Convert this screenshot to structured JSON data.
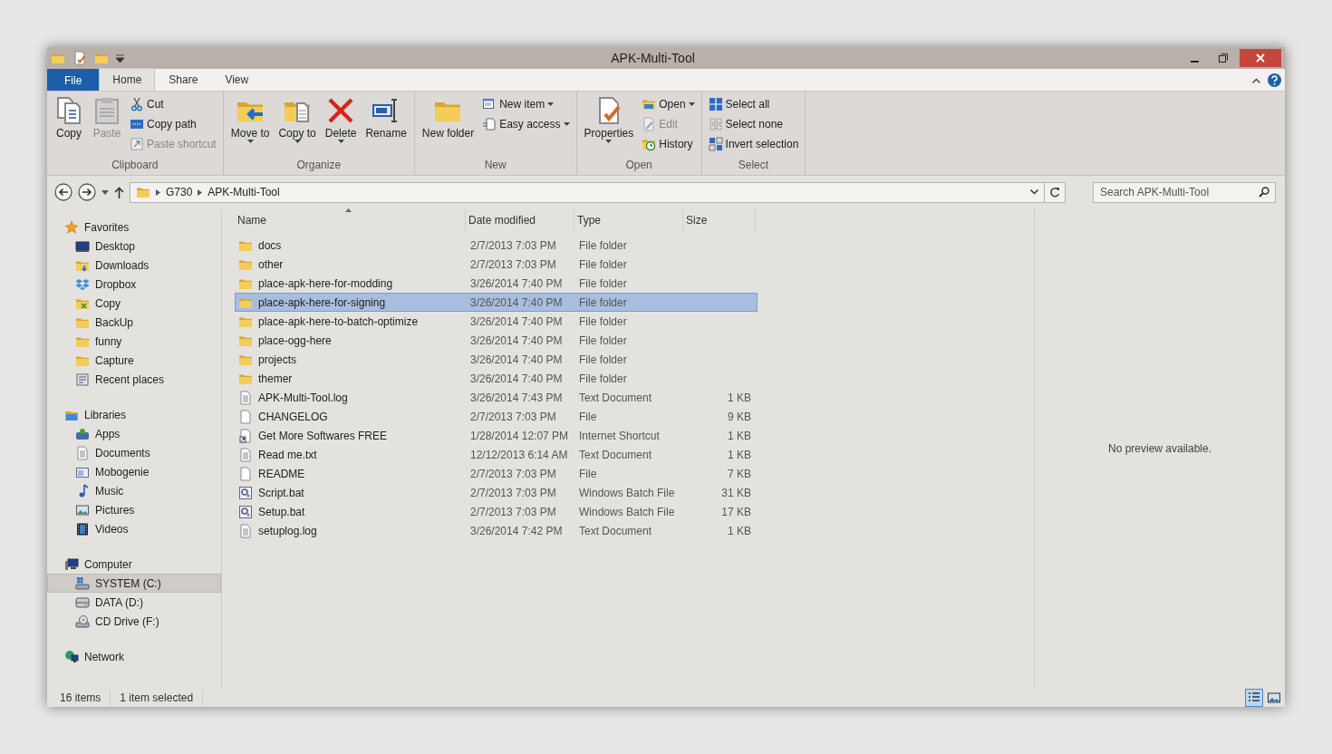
{
  "window": {
    "title": "APK-Multi-Tool"
  },
  "tabs": [
    {
      "label": "File",
      "kind": "file",
      "selected": false
    },
    {
      "label": "Home",
      "kind": "tab",
      "selected": true
    },
    {
      "label": "Share",
      "kind": "tab",
      "selected": false
    },
    {
      "label": "View",
      "kind": "tab",
      "selected": false
    }
  ],
  "ribbon": {
    "groups": [
      {
        "label": "Clipboard",
        "items": [
          {
            "label": "Copy",
            "large": true,
            "kind": "copy",
            "disabled": false,
            "dropdown": false
          },
          {
            "label": "Paste",
            "large": true,
            "kind": "paste",
            "disabled": true,
            "dropdown": false
          },
          {
            "label": "Cut",
            "large": false,
            "kind": "cut",
            "disabled": false,
            "dropdown": false
          },
          {
            "label": "Copy path",
            "large": false,
            "kind": "copy-path",
            "disabled": false,
            "dropdown": false
          },
          {
            "label": "Paste shortcut",
            "large": false,
            "kind": "paste-shortcut",
            "disabled": true,
            "dropdown": false
          }
        ]
      },
      {
        "label": "Organize",
        "items": [
          {
            "label": "Move to",
            "large": true,
            "kind": "move-to",
            "disabled": false,
            "dropdown": true
          },
          {
            "label": "Copy to",
            "large": true,
            "kind": "copy-to",
            "disabled": false,
            "dropdown": true
          },
          {
            "label": "Delete",
            "large": true,
            "kind": "delete",
            "disabled": false,
            "dropdown": true
          },
          {
            "label": "Rename",
            "large": true,
            "kind": "rename",
            "disabled": false,
            "dropdown": false
          }
        ]
      },
      {
        "label": "New",
        "items": [
          {
            "label": "New folder",
            "large": true,
            "kind": "new-folder",
            "disabled": false,
            "dropdown": false
          },
          {
            "label": "New item",
            "large": false,
            "kind": "new-item",
            "disabled": false,
            "dropdown": true
          },
          {
            "label": "Easy access",
            "large": false,
            "kind": "easy-access",
            "disabled": false,
            "dropdown": true
          }
        ]
      },
      {
        "label": "Open",
        "items": [
          {
            "label": "Properties",
            "large": true,
            "kind": "properties",
            "disabled": false,
            "dropdown": true
          },
          {
            "label": "Open",
            "large": false,
            "kind": "open",
            "disabled": false,
            "dropdown": true
          },
          {
            "label": "Edit",
            "large": false,
            "kind": "edit",
            "disabled": true,
            "dropdown": false
          },
          {
            "label": "History",
            "large": false,
            "kind": "history",
            "disabled": false,
            "dropdown": false
          }
        ]
      },
      {
        "label": "Select",
        "items": [
          {
            "label": "Select all",
            "large": false,
            "kind": "select-all",
            "disabled": false,
            "dropdown": false
          },
          {
            "label": "Select none",
            "large": false,
            "kind": "select-none",
            "disabled": false,
            "dropdown": false
          },
          {
            "label": "Invert selection",
            "large": false,
            "kind": "invert",
            "disabled": false,
            "dropdown": false
          }
        ]
      }
    ]
  },
  "address_bar": {
    "path": [
      "G730",
      "APK-Multi-Tool"
    ]
  },
  "search": {
    "placeholder": "Search APK-Multi-Tool"
  },
  "sidebar": {
    "groups": [
      {
        "label": "Favorites",
        "kind": "star",
        "selected": false,
        "children": [
          {
            "label": "Desktop",
            "kind": "desktop",
            "selected": false
          },
          {
            "label": "Downloads",
            "kind": "downloads",
            "selected": false
          },
          {
            "label": "Dropbox",
            "kind": "dropbox",
            "selected": false
          },
          {
            "label": "Copy",
            "kind": "folder-special",
            "selected": false
          },
          {
            "label": "BackUp",
            "kind": "folder",
            "selected": false
          },
          {
            "label": "funny",
            "kind": "folder",
            "selected": false
          },
          {
            "label": "Capture",
            "kind": "folder",
            "selected": false
          },
          {
            "label": "Recent places",
            "kind": "recent",
            "selected": false
          }
        ]
      },
      {
        "label": "Libraries",
        "kind": "library",
        "selected": false,
        "children": [
          {
            "label": "Apps",
            "kind": "apps",
            "selected": false
          },
          {
            "label": "Documents",
            "kind": "documents",
            "selected": false
          },
          {
            "label": "Mobogenie",
            "kind": "mobogenie",
            "selected": false
          },
          {
            "label": "Music",
            "kind": "music",
            "selected": false
          },
          {
            "label": "Pictures",
            "kind": "pictures",
            "selected": false
          },
          {
            "label": "Videos",
            "kind": "videos",
            "selected": false
          }
        ]
      },
      {
        "label": "Computer",
        "kind": "computer",
        "selected": false,
        "children": [
          {
            "label": "SYSTEM (C:)",
            "kind": "system-drive",
            "selected": true
          },
          {
            "label": "DATA (D:)",
            "kind": "drive",
            "selected": false
          },
          {
            "label": "CD Drive (F:)",
            "kind": "cd-drive",
            "selected": false
          }
        ]
      },
      {
        "label": "Network",
        "kind": "network",
        "selected": false
      }
    ]
  },
  "table": {
    "columns": [
      {
        "label": "Name",
        "sorted": true
      },
      {
        "label": "Date modified",
        "sorted": false
      },
      {
        "label": "Type",
        "sorted": false
      },
      {
        "label": "Size",
        "sorted": false
      }
    ],
    "rows": [
      {
        "name": "docs",
        "date": "2/7/2013 7:03 PM",
        "type": "File folder",
        "kind": "folder",
        "selected": false
      },
      {
        "name": "other",
        "date": "2/7/2013 7:03 PM",
        "type": "File folder",
        "kind": "folder",
        "selected": false
      },
      {
        "name": "place-apk-here-for-modding",
        "date": "3/26/2014 7:40 PM",
        "type": "File folder",
        "kind": "folder",
        "selected": false
      },
      {
        "name": "place-apk-here-for-signing",
        "date": "3/26/2014 7:40 PM",
        "type": "File folder",
        "kind": "folder",
        "selected": true
      },
      {
        "name": "place-apk-here-to-batch-optimize",
        "date": "3/26/2014 7:40 PM",
        "type": "File folder",
        "kind": "folder",
        "selected": false
      },
      {
        "name": "place-ogg-here",
        "date": "3/26/2014 7:40 PM",
        "type": "File folder",
        "kind": "folder",
        "selected": false
      },
      {
        "name": "projects",
        "date": "3/26/2014 7:40 PM",
        "type": "File folder",
        "kind": "folder",
        "selected": false
      },
      {
        "name": "themer",
        "date": "3/26/2014 7:40 PM",
        "type": "File folder",
        "kind": "folder",
        "selected": false
      },
      {
        "name": "APK-Multi-Tool.log",
        "date": "3/26/2014 7:43 PM",
        "type": "Text Document",
        "size": "1 KB",
        "kind": "text",
        "selected": false
      },
      {
        "name": "CHANGELOG",
        "date": "2/7/2013 7:03 PM",
        "type": "File",
        "size": "9 KB",
        "kind": "file",
        "selected": false
      },
      {
        "name": "Get More Softwares FREE",
        "date": "1/28/2014 12:07 PM",
        "type": "Internet Shortcut",
        "size": "1 KB",
        "kind": "shortcut",
        "selected": false
      },
      {
        "name": "Read me.txt",
        "date": "12/12/2013 6:14 AM",
        "type": "Text Document",
        "size": "1 KB",
        "kind": "text",
        "selected": false
      },
      {
        "name": "README",
        "date": "2/7/2013 7:03 PM",
        "type": "File",
        "size": "7 KB",
        "kind": "file",
        "selected": false
      },
      {
        "name": "Script.bat",
        "date": "2/7/2013 7:03 PM",
        "type": "Windows Batch File",
        "size": "31 KB",
        "kind": "batch",
        "selected": false
      },
      {
        "name": "Setup.bat",
        "date": "2/7/2013 7:03 PM",
        "type": "Windows Batch File",
        "size": "17 KB",
        "kind": "batch",
        "selected": false
      },
      {
        "name": "setuplog.log",
        "date": "3/26/2014 7:42 PM",
        "type": "Text Document",
        "size": "1 KB",
        "kind": "text",
        "selected": false
      }
    ]
  },
  "preview": {
    "message": "No preview available."
  },
  "status_bar": {
    "items": [
      "16 items",
      "1 item selected"
    ]
  },
  "view_buttons": [
    {
      "kind": "details",
      "selected": true
    },
    {
      "kind": "large-icons",
      "selected": false
    }
  ]
}
